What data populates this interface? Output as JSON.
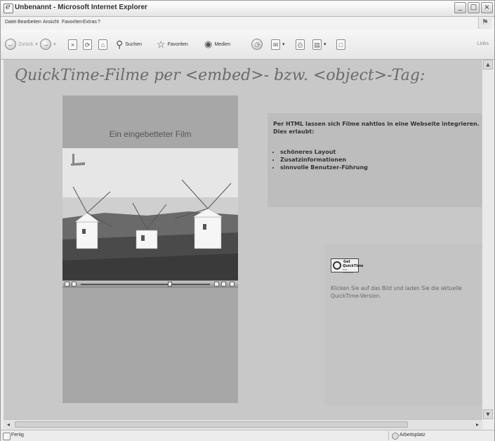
{
  "window": {
    "title": "Unbenannt - Microsoft Internet Explorer",
    "buttons": {
      "minimize": "_",
      "maximize": "□",
      "close": "×"
    }
  },
  "menu": {
    "items": [
      "Datei",
      "Bearbeiten",
      "Ansicht",
      "Favoriten",
      "Extras",
      "?"
    ]
  },
  "toolbar": {
    "back_label": "Zurück",
    "search_label": "Suchen",
    "favorites_label": "Favoriten",
    "media_label": "Medien",
    "links_label": "Links"
  },
  "page": {
    "heading": "QuickTime-Filme per <embed>- bzw. <object>-Tag:",
    "film_caption": "Ein eingebetteter Film",
    "info_intro": "Per HTML lassen sich Filme nahtlos in eine Webseite integrieren. Dies erlaubt:",
    "info_items": [
      "schöneres Layout",
      "Zusatzinformationen",
      "sinnvolle Benutzer-Führung"
    ],
    "qt_logo": {
      "line1": "Get",
      "line2": "QuickTime",
      "line3": "Free Download"
    },
    "qt_text": "Klicken Sie auf das Bild und laden Sie die aktuelle QuickTime-Version."
  },
  "status": {
    "text": "Fertig",
    "zone": "Arbeitsplatz"
  },
  "colors": {
    "page_background": "#c8c8c8",
    "film_panel": "#a7a7a7",
    "heading": "#6b6b6b"
  }
}
